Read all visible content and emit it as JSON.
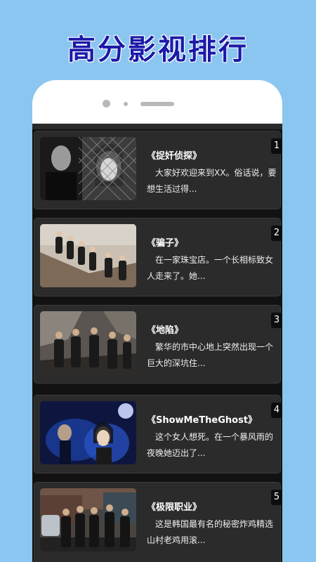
{
  "banner": {
    "title": "高分影视排行"
  },
  "list": [
    {
      "rank": "1",
      "title": "《捉奸侦探》",
      "desc": "大家好欢迎来到XX。俗话说，要想生活过得..."
    },
    {
      "rank": "2",
      "title": "《骗子》",
      "desc": "在一家珠宝店。一个长相标致女人走来了。她..."
    },
    {
      "rank": "3",
      "title": "《地陷》",
      "desc": "繁华的市中心地上突然出现一个巨大的深坑住..."
    },
    {
      "rank": "4",
      "title": "《ShowMeTheGhost》",
      "desc": "这个女人想死。在一个暴风雨的夜晚她迈出了..."
    },
    {
      "rank": "5",
      "title": "《极限职业》",
      "desc": "这是韩国最有名的秘密炸鸡精选山村老鸡用滚..."
    }
  ],
  "colors": {
    "background": "#8ac6f0",
    "title": "#1c1aa8",
    "card": "#2b2b2b"
  }
}
